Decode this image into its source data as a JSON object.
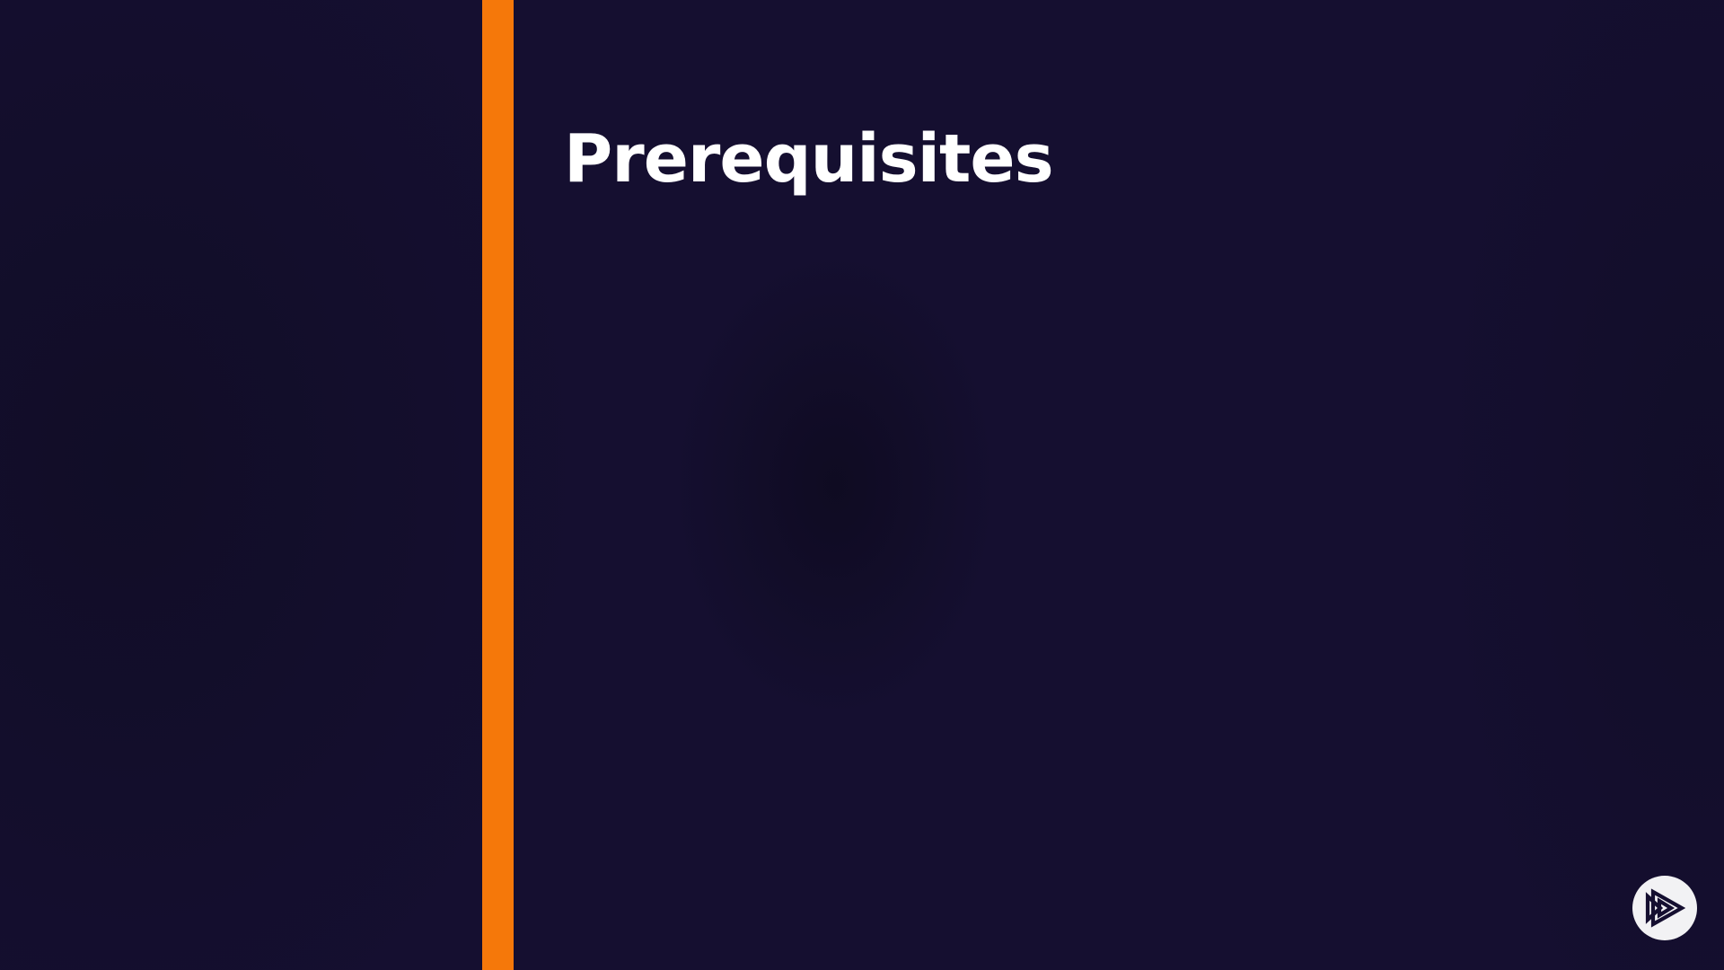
{
  "slide": {
    "title": "Prerequisites"
  },
  "colors": {
    "background": "#150f30",
    "accent": "#f5780a",
    "title": "#ffffff",
    "logo_background": "#f2f2f4",
    "logo_mark": "#150f30"
  },
  "logo": {
    "icon": "play-triangles-logo-icon"
  }
}
